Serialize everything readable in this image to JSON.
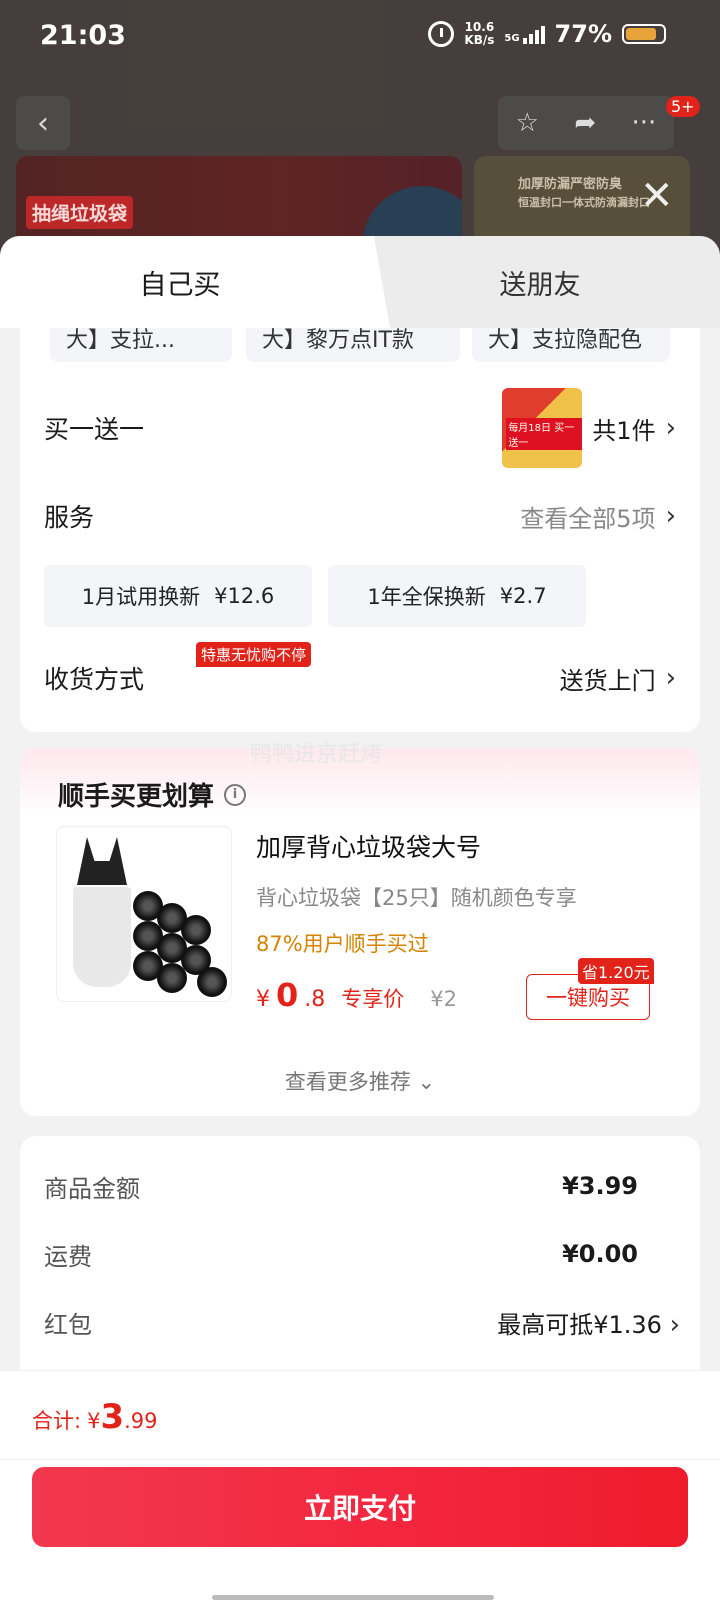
{
  "status_bar": {
    "time": "21:03",
    "net_speed_value": "10.6",
    "net_speed_unit": "KB/s",
    "network": "5G",
    "battery": "77%"
  },
  "background": {
    "badge_count": "5+",
    "banner_tag": "抽绳垃圾袋",
    "banner_right_text_1": "加厚防漏严密防臭",
    "banner_right_text_2": "恒温封口一体式防滴漏封口"
  },
  "tabs": {
    "self": "自己买",
    "friend": "送朋友"
  },
  "specs": [
    "大】支拉...",
    "大】黎万点IT款",
    "大】支拉隐配色"
  ],
  "gift": {
    "title": "买一送一",
    "count": "共1件",
    "thumb_text": "每月18日 买一送一"
  },
  "service": {
    "title": "服务",
    "view_all": "查看全部5项",
    "badge": "特惠无忧购不停",
    "options": [
      {
        "name": "1月试用换新",
        "price": "¥12.6"
      },
      {
        "name": "1年全保换新",
        "price": "¥2.7"
      }
    ]
  },
  "delivery": {
    "title": "收货方式",
    "value": "送货上门"
  },
  "watermark": "鸭鸭进京赶烤",
  "recommend": {
    "title": "顺手买更划算",
    "product": {
      "name": "加厚背心垃圾袋大号",
      "subtitle": "背心垃圾袋【25只】随机颜色专享",
      "social": "87%用户顺手买过",
      "price_symbol": "¥",
      "price_int": "0",
      "price_dec": ".8",
      "price_tag": "专享价",
      "original_price": "¥2",
      "save_badge": "省1.20元",
      "buy_label": "一键购买"
    },
    "more": "查看更多推荐"
  },
  "fees": [
    {
      "label": "商品金额",
      "value": "¥3.99"
    },
    {
      "label": "运费",
      "value": "¥0.00"
    },
    {
      "label": "红包",
      "value": "最高可抵¥1.36"
    }
  ],
  "footer": {
    "total_label": "合计:",
    "total_symbol": "¥",
    "total_int": "3",
    "total_dec": ".99",
    "pay_label": "立即支付"
  }
}
